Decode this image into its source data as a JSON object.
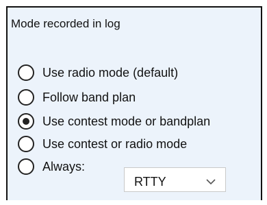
{
  "group": {
    "title": "Mode recorded in log"
  },
  "options": [
    {
      "label": "Use radio mode (default)",
      "checked": false
    },
    {
      "label": "Follow band plan",
      "checked": false
    },
    {
      "label": "Use contest mode or bandplan",
      "checked": true
    },
    {
      "label": "Use contest or radio mode",
      "checked": false
    },
    {
      "label": "Always:",
      "checked": false
    }
  ],
  "always_mode": {
    "selected": "RTTY",
    "icon": "chevron-down-icon"
  },
  "colors": {
    "group_background": "#ecf3fb",
    "border": "#111111",
    "text": "#111111"
  }
}
